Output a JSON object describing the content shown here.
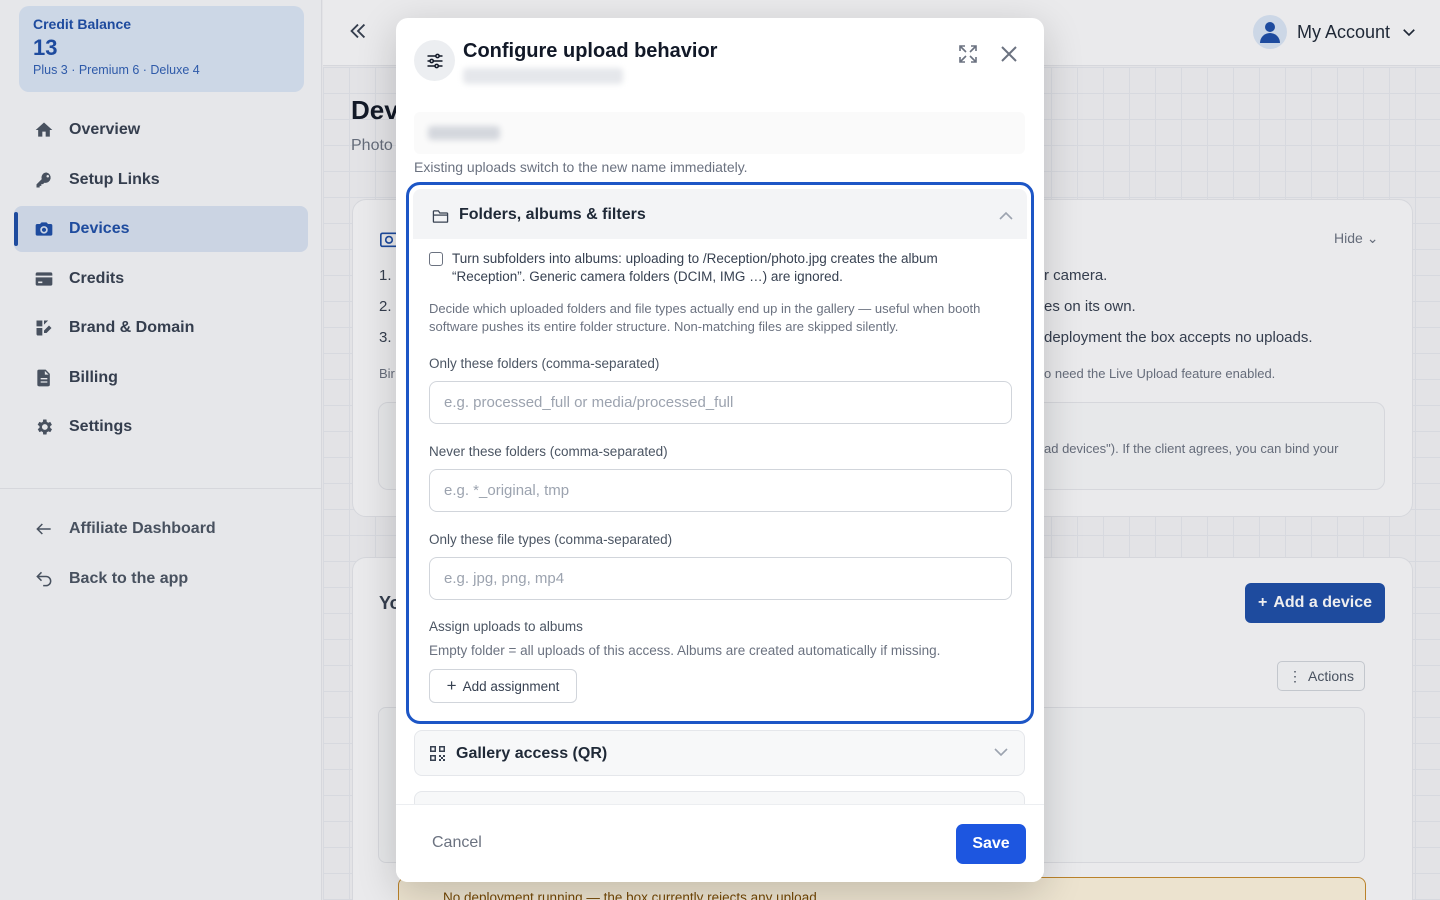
{
  "sidebar": {
    "credit": {
      "label": "Credit Balance",
      "value": "13",
      "breakdown": "Plus 3 · Premium 6 · Deluxe 4"
    },
    "items": [
      {
        "label": "Overview",
        "icon": "home-icon"
      },
      {
        "label": "Setup Links",
        "icon": "key-icon"
      },
      {
        "label": "Devices",
        "icon": "camera-icon",
        "active": true
      },
      {
        "label": "Credits",
        "icon": "card-icon"
      },
      {
        "label": "Brand & Domain",
        "icon": "brush-icon"
      },
      {
        "label": "Billing",
        "icon": "document-icon"
      },
      {
        "label": "Settings",
        "icon": "gear-icon"
      }
    ],
    "secondary": [
      {
        "label": "Affiliate Dashboard",
        "icon": "arrow-left-icon"
      },
      {
        "label": "Back to the app",
        "icon": "return-icon"
      }
    ]
  },
  "topbar": {
    "account_label": "My Account"
  },
  "background": {
    "page_title": "Dev",
    "page_sub": "Photo",
    "hide_label": "Hide",
    "step1": "1.",
    "step2": "2.",
    "step3": "3.",
    "line1": "r camera.",
    "line2": "es on its own.",
    "line3": "deployment the box accepts no uploads.",
    "note_left": "Bir",
    "note": "o need the Live Upload feature enabled.",
    "box_text": "ad devices\"). If the client agrees, you can bind your",
    "section_title_partial": "Yo",
    "add_device_label": "Add a device",
    "actions_label": "Actions",
    "warn_text": "No deployment running — the box currently rejects any upload."
  },
  "modal": {
    "title": "Configure upload behavior",
    "name_hint": "Existing uploads switch to the new name immediately.",
    "section": {
      "title": "Folders, albums & filters",
      "checkbox_label": "Turn subfolders into albums: uploading to /Reception/photo.jpg creates the album “Reception”. Generic camera folders (DCIM, IMG …) are ignored.",
      "checkbox_checked": false,
      "description": "Decide which uploaded folders and file types actually end up in the gallery — useful when booth software pushes its entire folder structure. Non-matching files are skipped silently.",
      "only_folders_label": "Only these folders (comma-separated)",
      "only_folders_placeholder": "e.g. processed_full or media/processed_full",
      "only_folders_value": "",
      "never_folders_label": "Never these folders (comma-separated)",
      "never_folders_placeholder": "e.g. *_original, tmp",
      "never_folders_value": "",
      "file_types_label": "Only these file types (comma-separated)",
      "file_types_placeholder": "e.g. jpg, png, mp4",
      "file_types_value": "",
      "assign_title": "Assign uploads to albums",
      "assign_note": "Empty folder = all uploads of this access. Albums are created automatically if missing.",
      "add_assignment_label": "Add assignment"
    },
    "section2_title": "Gallery access (QR)",
    "cancel_label": "Cancel",
    "save_label": "Save"
  },
  "colors": {
    "accent": "#1d56e0",
    "focus_ring": "#1d56c6",
    "sidebar_active": "#1e4fa8"
  }
}
